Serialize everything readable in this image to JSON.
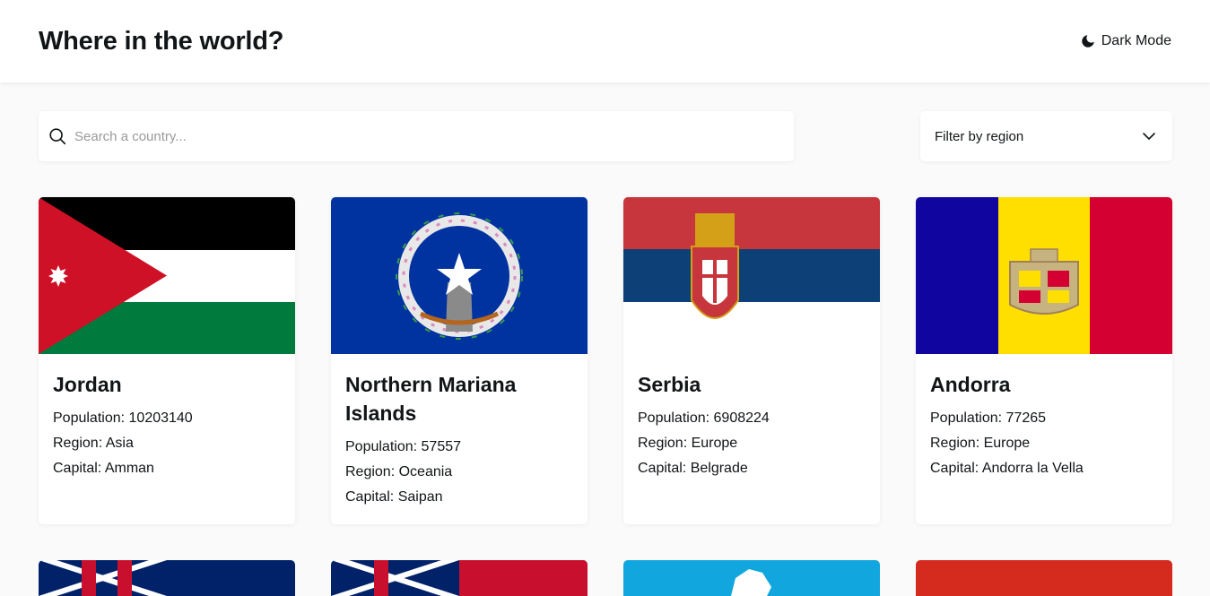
{
  "header": {
    "title": "Where in the world?",
    "theme_toggle_label": "Dark Mode"
  },
  "search": {
    "placeholder": "Search a country...",
    "value": ""
  },
  "filter": {
    "label": "Filter by region"
  },
  "labels": {
    "population": "Population:",
    "region": "Region:",
    "capital": "Capital:"
  },
  "countries": [
    {
      "name": "Jordan",
      "population": "10203140",
      "region": "Asia",
      "capital": "Amman",
      "flag": "jordan-flag"
    },
    {
      "name": "Northern Mariana Islands",
      "population": "57557",
      "region": "Oceania",
      "capital": "Saipan",
      "flag": "northern-mariana-islands-flag"
    },
    {
      "name": "Serbia",
      "population": "6908224",
      "region": "Europe",
      "capital": "Belgrade",
      "flag": "serbia-flag"
    },
    {
      "name": "Andorra",
      "population": "77265",
      "region": "Europe",
      "capital": "Andorra la Vella",
      "flag": "andorra-flag"
    }
  ],
  "colors": {
    "background": "#fafafa",
    "card": "#ffffff",
    "text": "#111517"
  }
}
